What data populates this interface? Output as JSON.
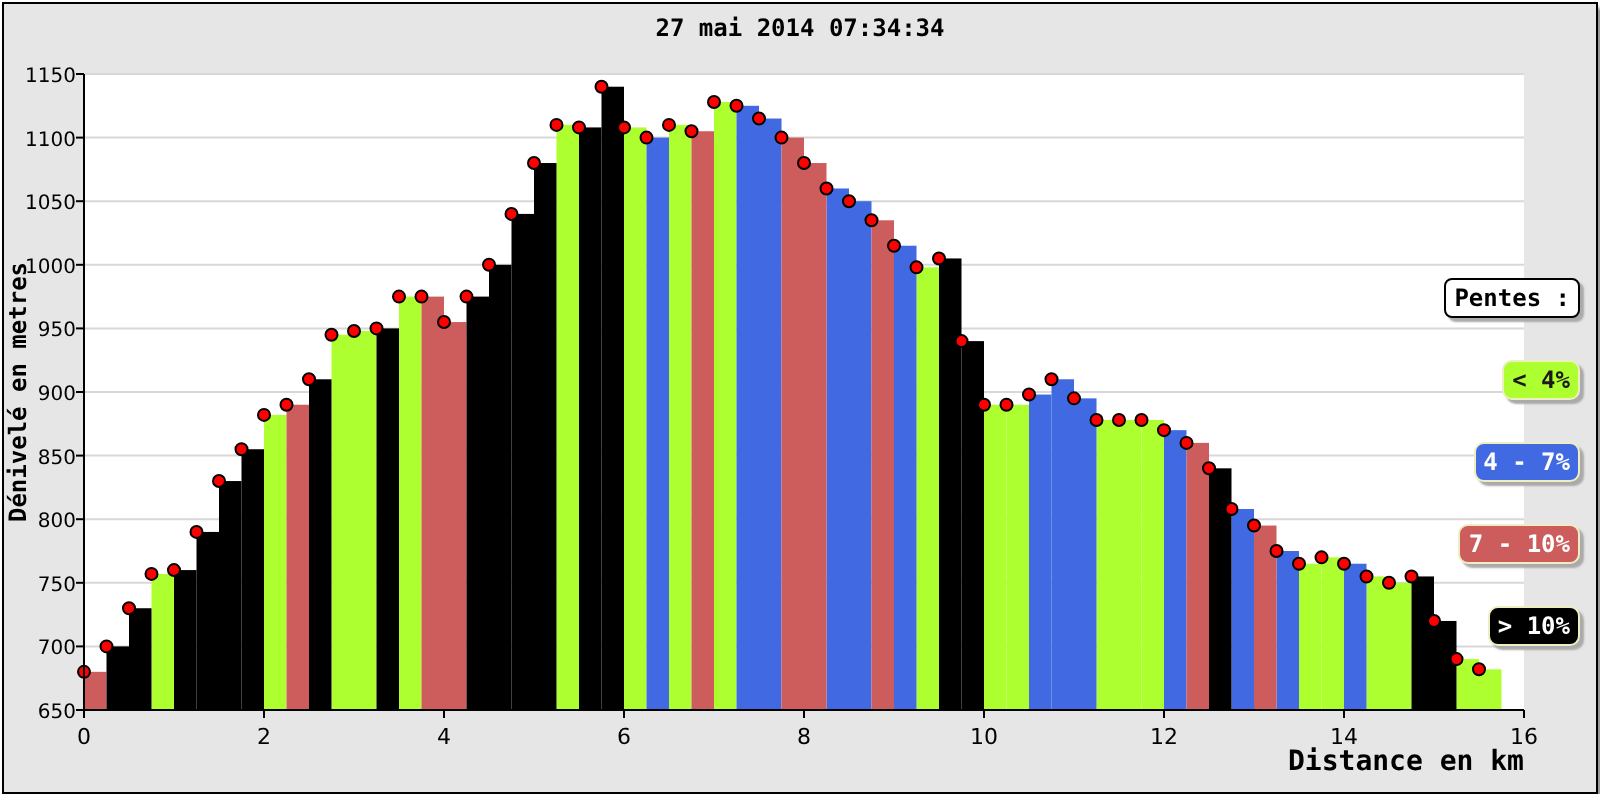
{
  "chart": {
    "chart_data": {
      "type": "bar",
      "title": "27 mai 2014 07:34:34",
      "xlabel": "Distance en km",
      "ylabel": "Dénivelé en metres",
      "x": [
        0,
        0.25,
        0.5,
        0.75,
        1,
        1.25,
        1.5,
        1.75,
        2,
        2.25,
        2.5,
        2.75,
        3,
        3.25,
        3.5,
        3.75,
        4,
        4.25,
        4.5,
        4.75,
        5,
        5.25,
        5.5,
        5.75,
        6,
        6.25,
        6.5,
        6.75,
        7,
        7.25,
        7.5,
        7.75,
        8,
        8.25,
        8.5,
        8.75,
        9,
        9.25,
        9.5,
        9.75,
        10,
        10.25,
        10.5,
        10.75,
        11,
        11.25,
        11.5,
        11.75,
        12,
        12.25,
        12.5,
        12.75,
        13,
        13.25,
        13.5,
        13.75,
        14,
        14.25,
        14.5,
        14.75,
        15,
        15.25,
        15.5
      ],
      "series": [
        {
          "name": "< 4%",
          "color": "#adff2f",
          "values": [
            null,
            null,
            null,
            757,
            null,
            null,
            null,
            null,
            882,
            null,
            null,
            945,
            948,
            null,
            975,
            null,
            null,
            null,
            null,
            null,
            null,
            1110,
            null,
            null,
            1108,
            null,
            1110,
            null,
            1128,
            null,
            null,
            null,
            null,
            null,
            null,
            null,
            null,
            998,
            null,
            null,
            890,
            890,
            null,
            null,
            null,
            878,
            878,
            878,
            null,
            null,
            null,
            null,
            null,
            null,
            765,
            770,
            null,
            755,
            750,
            null,
            null,
            690,
            682
          ]
        },
        {
          "name": "4 - 7%",
          "color": "#4169e1",
          "values": [
            null,
            null,
            null,
            null,
            null,
            null,
            null,
            null,
            null,
            null,
            null,
            null,
            null,
            null,
            null,
            null,
            null,
            null,
            null,
            null,
            null,
            null,
            null,
            null,
            null,
            1100,
            null,
            null,
            null,
            1125,
            1115,
            null,
            null,
            1060,
            1050,
            null,
            1015,
            null,
            null,
            null,
            null,
            null,
            898,
            910,
            895,
            null,
            null,
            null,
            870,
            null,
            null,
            808,
            null,
            775,
            null,
            null,
            765,
            null,
            null,
            null,
            null,
            null,
            null
          ]
        },
        {
          "name": "7 - 10%",
          "color": "#cd5c5c",
          "values": [
            680,
            null,
            null,
            null,
            null,
            null,
            null,
            null,
            null,
            890,
            null,
            null,
            null,
            null,
            null,
            975,
            955,
            null,
            null,
            null,
            null,
            null,
            null,
            null,
            null,
            null,
            null,
            1105,
            null,
            null,
            null,
            1100,
            1080,
            null,
            null,
            1035,
            null,
            null,
            null,
            null,
            null,
            null,
            null,
            null,
            null,
            null,
            null,
            null,
            null,
            860,
            null,
            null,
            795,
            null,
            null,
            null,
            null,
            null,
            null,
            null,
            null,
            null,
            null
          ]
        },
        {
          "name": "> 10%",
          "color": "#000000",
          "values": [
            null,
            700,
            730,
            null,
            760,
            790,
            830,
            855,
            null,
            null,
            910,
            null,
            null,
            950,
            null,
            null,
            null,
            975,
            1000,
            1040,
            1080,
            null,
            1108,
            1140,
            null,
            null,
            null,
            null,
            null,
            null,
            null,
            null,
            null,
            null,
            null,
            null,
            null,
            null,
            1005,
            940,
            null,
            null,
            null,
            null,
            null,
            null,
            null,
            null,
            null,
            null,
            840,
            null,
            null,
            null,
            null,
            null,
            null,
            null,
            null,
            755,
            720,
            null,
            null
          ]
        }
      ],
      "xlim": [
        0,
        16
      ],
      "ylim": [
        650,
        1150
      ],
      "xticks": [
        0,
        2,
        4,
        6,
        8,
        10,
        12,
        14,
        16
      ],
      "yticks": [
        650,
        700,
        750,
        800,
        850,
        900,
        950,
        1000,
        1050,
        1100,
        1150
      ],
      "grid": true
    },
    "legend": {
      "title": "Pentes :"
    }
  }
}
